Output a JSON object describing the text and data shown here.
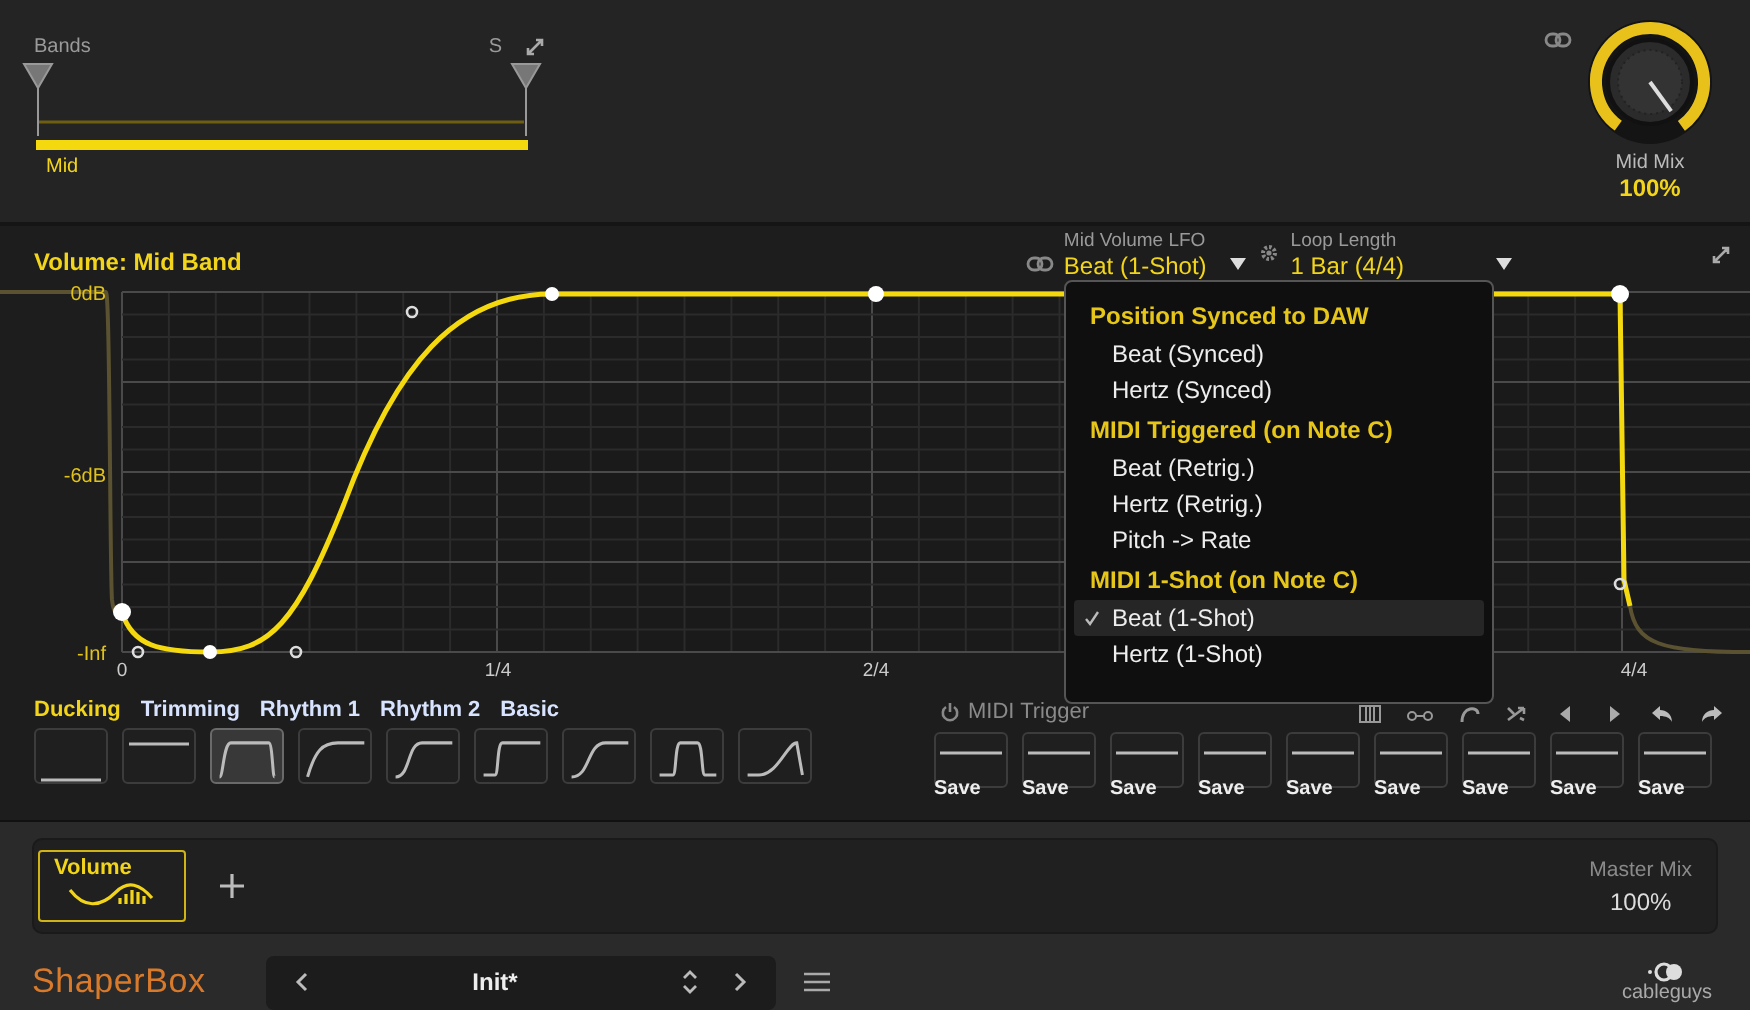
{
  "bands": {
    "label": "Bands",
    "solo": "S",
    "band_name": "Mid"
  },
  "mix_knob": {
    "label": "Mid Mix",
    "value": "100%",
    "level": 1
  },
  "editor": {
    "title": "Volume: Mid Band",
    "lfo": {
      "label": "Mid Volume LFO",
      "value": "Beat (1-Shot)"
    },
    "loop": {
      "label": "Loop Length",
      "value": "1 Bar (4/4)"
    },
    "y_labels": [
      "0dB",
      "-6dB",
      "-Inf"
    ],
    "x_labels": [
      "0",
      "1/4",
      "2/4",
      "4/4"
    ]
  },
  "lfo_menu": {
    "sections": [
      {
        "heading": "Position Synced to DAW",
        "items": [
          {
            "label": "Beat (Synced)",
            "selected": false
          },
          {
            "label": "Hertz (Synced)",
            "selected": false
          }
        ]
      },
      {
        "heading": "MIDI Triggered (on Note C)",
        "items": [
          {
            "label": "Beat (Retrig.)",
            "selected": false
          },
          {
            "label": "Hertz (Retrig.)",
            "selected": false
          },
          {
            "label": "Pitch -> Rate",
            "selected": false
          }
        ]
      },
      {
        "heading": "MIDI 1-Shot (on Note C)",
        "items": [
          {
            "label": "Beat (1-Shot)",
            "selected": true
          },
          {
            "label": "Hertz (1-Shot)",
            "selected": false
          }
        ]
      }
    ]
  },
  "presets": {
    "categories": [
      {
        "label": "Ducking",
        "selected": true
      },
      {
        "label": "Trimming",
        "selected": false
      },
      {
        "label": "Rhythm 1",
        "selected": false
      },
      {
        "label": "Rhythm 2",
        "selected": false
      },
      {
        "label": "Basic",
        "selected": false
      }
    ],
    "shapes": [
      {
        "kind": "low",
        "selected": false
      },
      {
        "kind": "high",
        "selected": false
      },
      {
        "kind": "gate",
        "selected": true
      },
      {
        "kind": "rise",
        "selected": false
      },
      {
        "kind": "scurve",
        "selected": false
      },
      {
        "kind": "step",
        "selected": false
      },
      {
        "kind": "soft",
        "selected": false
      },
      {
        "kind": "pulse",
        "selected": false
      },
      {
        "kind": "ramp",
        "selected": false
      }
    ]
  },
  "midi_trigger": {
    "label": "MIDI Trigger",
    "on": false,
    "slots": [
      "Save",
      "Save",
      "Save",
      "Save",
      "Save",
      "Save",
      "Save",
      "Save",
      "Save"
    ]
  },
  "effects": {
    "tabs": [
      {
        "label": "Volume",
        "selected": true
      }
    ]
  },
  "master_mix": {
    "label": "Master Mix",
    "value": "100%"
  },
  "footer": {
    "logo": "ShaperBox",
    "preset": "Init*",
    "brand": "cableguys"
  }
}
